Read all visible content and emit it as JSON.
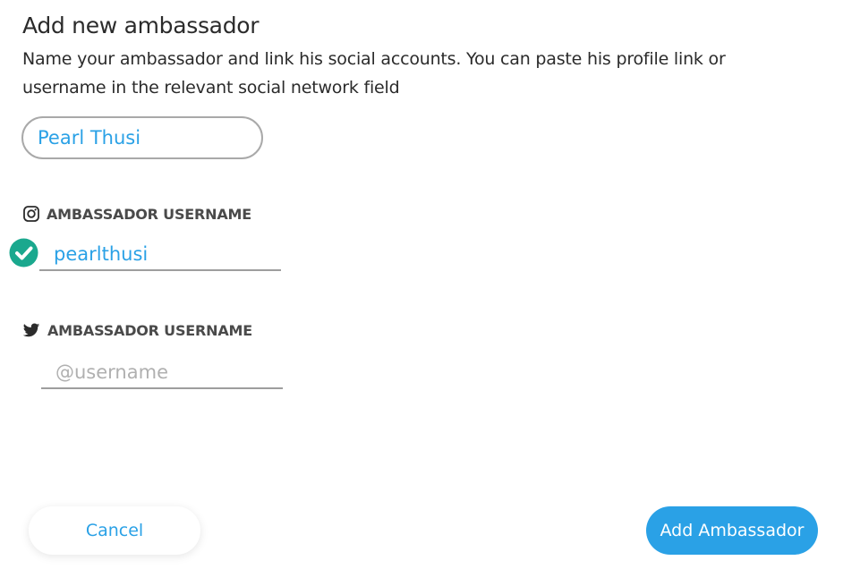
{
  "header": {
    "title": "Add new ambassador",
    "subtitle": "Name your ambassador and link his social accounts. You can paste his profile link or username in the relevant social network field"
  },
  "name_field": {
    "value": "Pearl Thusi"
  },
  "instagram": {
    "label": "AMBASSADOR USERNAME",
    "value": "pearlthusi",
    "icon": "instagram-icon",
    "verified_icon": "check-circle-icon"
  },
  "twitter": {
    "label": "AMBASSADOR USERNAME",
    "value": "",
    "placeholder": "@username",
    "icon": "twitter-icon"
  },
  "footer": {
    "cancel_label": "Cancel",
    "add_label": "Add Ambassador"
  },
  "colors": {
    "accent": "#2aa1e6",
    "success": "#1aa88e",
    "text": "#2b2b2b"
  }
}
